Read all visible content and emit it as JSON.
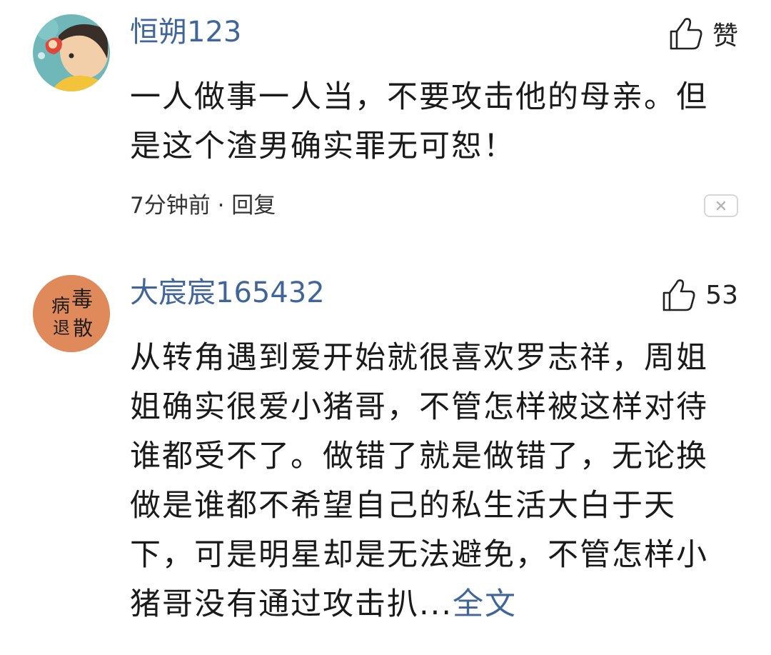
{
  "comments": [
    {
      "username": "恒朔123",
      "like_label": "赞",
      "content": "一人做事一人当，不要攻击他的母亲。但是这个渣男确实罪无可恕！",
      "time": "7分钟前",
      "separator": " · ",
      "reply_label": "回复",
      "avatar_icon": "anime-avatar-icon",
      "dismiss_icon": "close-icon"
    },
    {
      "username": "大宸宸165432",
      "like_label": "53",
      "content": "从转角遇到爱开始就很喜欢罗志祥，周姐姐确实很爱小猪哥，不管怎样被这样对待谁都受不了。做错了就是做错了，无论换做是谁都不希望自己的私生活大白于天下，可是明星却是无法避免，不管怎样小猪哥没有通过攻击扒...",
      "more_label": "全文",
      "avatar_text": "病毒退散",
      "avatar_icon": "calligraphy-avatar-icon"
    }
  ],
  "colors": {
    "username": "#406599",
    "link": "#406599",
    "text": "#1a1a1a",
    "meta": "#333333",
    "avatar2_bg": "#E08A5C"
  }
}
